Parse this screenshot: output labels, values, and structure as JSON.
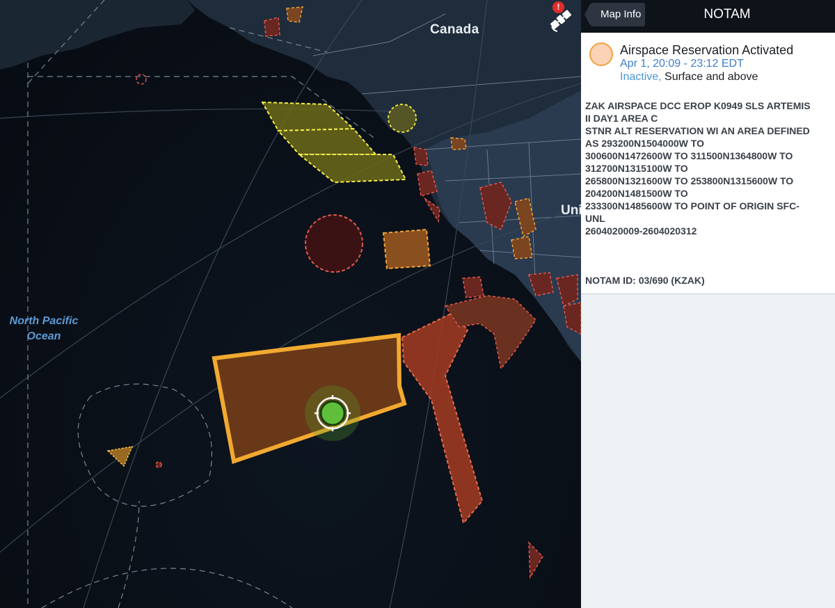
{
  "map": {
    "labels": {
      "canada": "Canada",
      "united": "Uni",
      "ocean_line1": "North Pacific",
      "ocean_line2": "Ocean"
    },
    "icons": {
      "satellite": "satellite-icon",
      "alert_badge": "alert-badge-icon",
      "target": "crosshair-target-icon"
    },
    "colors": {
      "ocean": "#0a0f17",
      "land": "#243447",
      "airspace_orange": "#f0a23c",
      "airspace_red": "#d9442d",
      "airspace_yellow": "#e8e84a",
      "target_green": "#5fbf3a"
    }
  },
  "panel": {
    "map_info_label": "Map Info",
    "title": "NOTAM",
    "notam": {
      "heading": "Airspace Reservation Activated",
      "time_range": "Apr 1, 20:09 - 23:12 EDT",
      "status": "Inactive,",
      "altitude": " Surface and above",
      "text_lines": [
        "ZAK AIRSPACE DCC EROP K0949 SLS ARTEMIS",
        "II DAY1 AREA C",
        "STNR ALT RESERVATION WI AN AREA DEFINED",
        "AS 293200N1504000W TO",
        "300600N1472600W TO 311500N1364800W TO",
        "312700N1315100W TO",
        "265800N1321600W TO 253800N1315600W TO",
        "204200N1481500W TO",
        "233300N1485600W TO POINT OF ORIGIN SFC-",
        "UNL",
        "2604020009-2604020312"
      ],
      "id_label": "NOTAM ID: 03/690 (KZAK)"
    }
  }
}
